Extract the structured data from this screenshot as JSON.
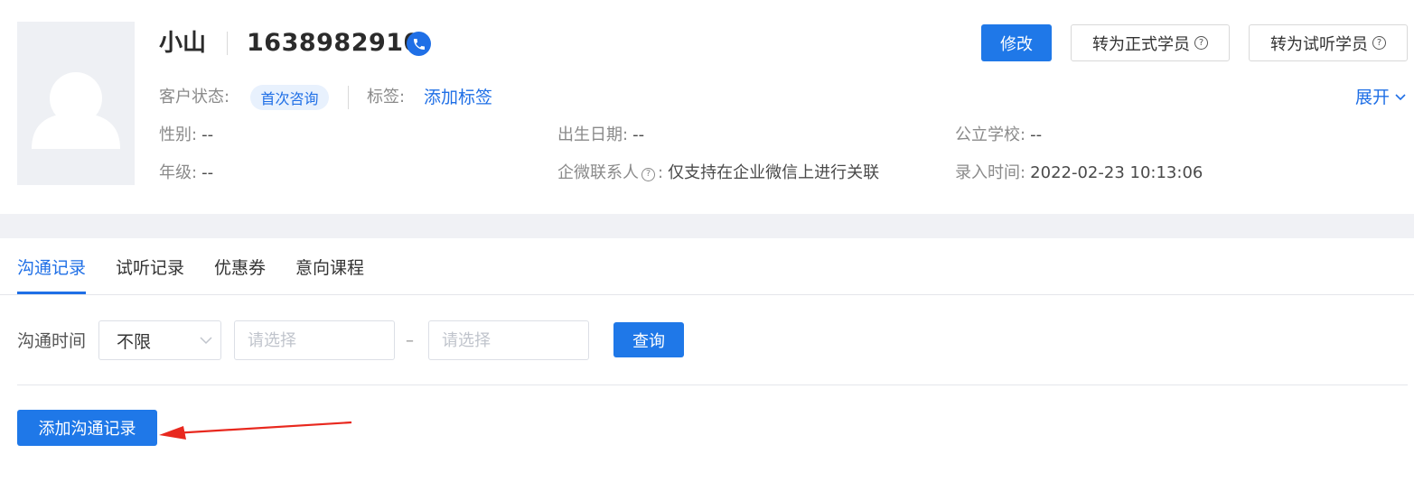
{
  "customer": {
    "name": "小山",
    "phone": "1638982910",
    "status_label": "客户状态:",
    "status_value": "首次咨询",
    "tags_label": "标签:",
    "add_tag_link": "添加标签",
    "expand_link": "展开",
    "gender_label": "性别:",
    "gender_value": "--",
    "birth_label": "出生日期:",
    "birth_value": "--",
    "school_label": "公立学校:",
    "school_value": "--",
    "grade_label": "年级:",
    "grade_value": "--",
    "wecom_label": "企微联系人",
    "wecom_colon": ":",
    "wecom_value": "仅支持在企业微信上进行关联",
    "entry_label": "录入时间:",
    "entry_value": "2022-02-23 10:13:06"
  },
  "actions": {
    "edit": "修改",
    "to_formal": "转为正式学员",
    "to_trial": "转为试听学员"
  },
  "tabs": [
    {
      "label": "沟通记录",
      "active": true
    },
    {
      "label": "试听记录",
      "active": false
    },
    {
      "label": "优惠券",
      "active": false
    },
    {
      "label": "意向课程",
      "active": false
    }
  ],
  "filter": {
    "label": "沟通时间",
    "select_value": "不限",
    "start_placeholder": "请选择",
    "separator": "–",
    "end_placeholder": "请选择",
    "query_button": "查询"
  },
  "add_record_button": "添加沟通记录",
  "colors": {
    "primary": "#1f78e8",
    "link": "#1f6fe6",
    "annotation_arrow": "#e8281e"
  },
  "icons": [
    "avatar-placeholder-icon",
    "phone-icon",
    "help-icon",
    "chevron-down-icon"
  ]
}
